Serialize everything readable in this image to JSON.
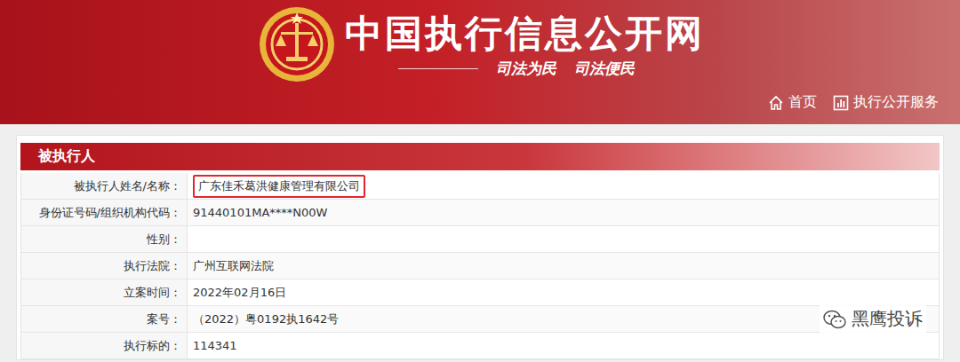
{
  "header": {
    "title": "中国执行信息公开网",
    "slogans": [
      "司法为民",
      "司法便民"
    ],
    "nav": [
      {
        "label": "首页"
      },
      {
        "label": "执行公开服务"
      }
    ]
  },
  "panel": {
    "title": "被执行人",
    "rows": [
      {
        "label": "被执行人姓名/名称：",
        "value": "广东佳禾葛洪健康管理有限公司",
        "highlighted": true
      },
      {
        "label": "身份证号码/组织机构代码：",
        "value": "91440101MA****N00W",
        "highlighted": false
      },
      {
        "label": "性别：",
        "value": "",
        "highlighted": false
      },
      {
        "label": "执行法院：",
        "value": "广州互联网法院",
        "highlighted": false
      },
      {
        "label": "立案时间：",
        "value": "2022年02月16日",
        "highlighted": false
      },
      {
        "label": "案号：",
        "value": "（2022）粤0192执1642号",
        "highlighted": false
      },
      {
        "label": "执行标的：",
        "value": "114341",
        "highlighted": false
      }
    ]
  },
  "watermark": "黑鹰投诉"
}
